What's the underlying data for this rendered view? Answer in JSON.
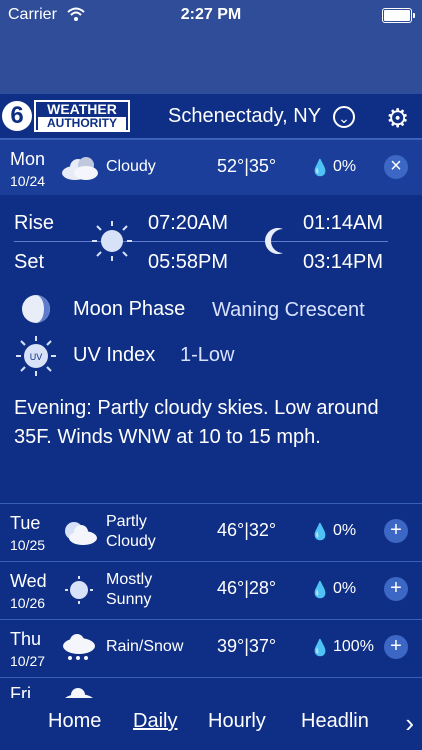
{
  "status": {
    "carrier": "Carrier",
    "time": "2:27 PM"
  },
  "header": {
    "logo_number": "6",
    "logo_line1": "WEATHER",
    "logo_line2": "AUTHORITY",
    "city": "Schenectady, NY"
  },
  "today": {
    "dow": "Mon",
    "date": "10/24",
    "condition": "Cloudy",
    "temps": "52°|35°",
    "precip": "0%",
    "close_symbol": "×",
    "sunrise_label": "Rise",
    "sunset_label": "Set",
    "sunrise": "07:20AM",
    "sunset": "05:58PM",
    "moonrise": "01:14AM",
    "moonset": "03:14PM",
    "moon_phase_label": "Moon Phase",
    "moon_phase": "Waning Crescent",
    "uv_label": "UV Index",
    "uv_value": "1-Low",
    "uv_badge": "UV",
    "forecast": "Evening: Partly cloudy skies. Low around 35F. Winds WNW at 10 to 15 mph."
  },
  "days": [
    {
      "dow": "Tue",
      "date": "10/25",
      "condition_line1": "Partly",
      "condition_line2": "Cloudy",
      "temps": "46°|32°",
      "precip": "0%",
      "expand": "+"
    },
    {
      "dow": "Wed",
      "date": "10/26",
      "condition_line1": "Mostly",
      "condition_line2": "Sunny",
      "temps": "46°|28°",
      "precip": "0%",
      "expand": "+"
    },
    {
      "dow": "Thu",
      "date": "10/27",
      "condition": "Rain/Snow",
      "temps": "39°|37°",
      "precip": "100%",
      "expand": "+"
    },
    {
      "dow": "Fri"
    }
  ],
  "nav": {
    "home": "Home",
    "daily": "Daily",
    "hourly": "Hourly",
    "headlines": "Headlin",
    "next_arrow": "›"
  },
  "colors": {
    "background": "#0f2f86",
    "banner": "#2f4d98",
    "active_row": "#1a3e9a",
    "button": "#3c67c4"
  },
  "icons": {
    "wifi": "wifi-icon",
    "battery": "battery-icon",
    "dropdown": "chevron-down-icon",
    "settings": "gear-icon",
    "cloud": "cloud-icon",
    "sun": "sun-icon",
    "moon": "moon-icon",
    "raindrop": "raindrop-icon",
    "uv": "uv-icon"
  }
}
